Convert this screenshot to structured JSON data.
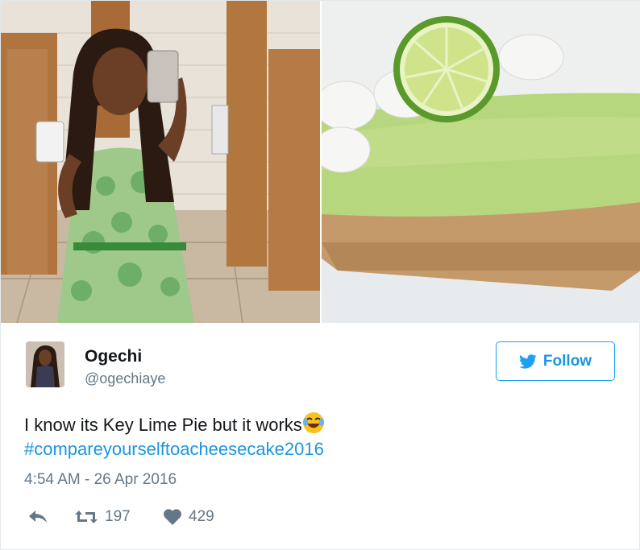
{
  "tweet": {
    "name": "Ogechi",
    "handle": "@ogechiaye",
    "follow_label": "Follow",
    "text": "I know its Key Lime Pie but it works",
    "hashtag": "#compareyourselftoacheesecake2016",
    "timestamp": "4:54 AM - 26 Apr 2016",
    "retweet_count": "197",
    "like_count": "429"
  },
  "icons": {
    "follow": "twitter-bird-icon",
    "reply": "reply-icon",
    "retweet": "retweet-icon",
    "like": "heart-icon",
    "emoji": "face-with-tears-of-joy-emoji"
  },
  "colors": {
    "accent": "#1b95e0",
    "muted": "#657786",
    "text": "#14171a"
  }
}
